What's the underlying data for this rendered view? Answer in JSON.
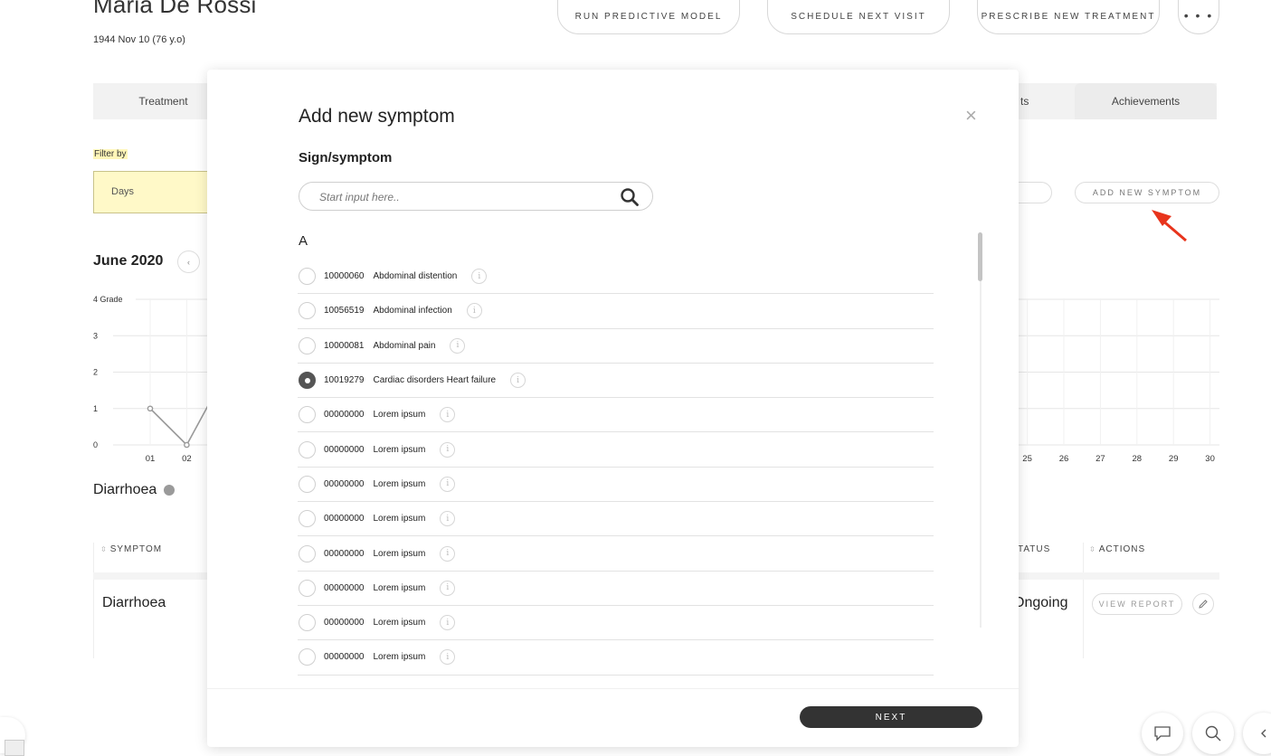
{
  "patient": {
    "name": "Maria De Rossi",
    "dob": "1944 Nov 10 (76 y.o)"
  },
  "top_actions": {
    "run_model": "RUN PREDICTIVE MODEL",
    "schedule_visit": "SCHEDULE NEXT VISIT",
    "prescribe": "PRESCRIBE NEW TREATMENT",
    "more": "• • •"
  },
  "tabs": {
    "treatment": "Treatment",
    "partial_tab": "ts",
    "achievements": "Achievements"
  },
  "filter": {
    "label": "Filter by",
    "value": "Days"
  },
  "add_symptom_button": "ADD NEW SYMPTOM",
  "calendar": {
    "month": "June 2020",
    "prev_icon": "chevron-left-icon"
  },
  "chart_data": {
    "type": "line",
    "ylabel": "",
    "yticks": [
      "4 Grade",
      "3",
      "2",
      "1",
      "0"
    ],
    "ylim": [
      0,
      4
    ],
    "x_ticks_visible_left": [
      "01",
      "02"
    ],
    "x_ticks_visible_right": [
      "25",
      "26",
      "27",
      "28",
      "29",
      "30"
    ],
    "grid": true,
    "series": [
      {
        "name": "Diarrhoea",
        "color": "#9a9a9a",
        "x": [
          "01",
          "02"
        ],
        "values": [
          1,
          0
        ]
      }
    ]
  },
  "legend": {
    "symptom": "Diarrhoea"
  },
  "table": {
    "headers": {
      "symptom": "SYMPTOM",
      "status": "TATUS",
      "actions": "ACTIONS"
    },
    "row": {
      "symptom": "Diarrhoea",
      "status": "Ongoing",
      "view_report": "VIEW REPORT"
    }
  },
  "modal": {
    "title": "Add new symptom",
    "close": "×",
    "subtitle": "Sign/symptom",
    "search_placeholder": "Start input here..",
    "letter": "A",
    "next": "NEXT",
    "items": [
      {
        "code": "10000060",
        "label": "Abdominal distention",
        "checked": false
      },
      {
        "code": "10056519",
        "label": "Abdominal infection",
        "checked": false
      },
      {
        "code": "10000081",
        "label": "Abdominal pain",
        "checked": false
      },
      {
        "code": "10019279",
        "label": "Cardiac disorders Heart failure",
        "checked": true
      },
      {
        "code": "00000000",
        "label": "Lorem ipsum",
        "checked": false
      },
      {
        "code": "00000000",
        "label": "Lorem ipsum",
        "checked": false
      },
      {
        "code": "00000000",
        "label": "Lorem ipsum",
        "checked": false
      },
      {
        "code": "00000000",
        "label": "Lorem ipsum",
        "checked": false
      },
      {
        "code": "00000000",
        "label": "Lorem ipsum",
        "checked": false
      },
      {
        "code": "00000000",
        "label": "Lorem ipsum",
        "checked": false
      },
      {
        "code": "00000000",
        "label": "Lorem ipsum",
        "checked": false
      },
      {
        "code": "00000000",
        "label": "Lorem ipsum",
        "checked": false
      }
    ]
  },
  "colors": {
    "filter_bg": "#fff9c8",
    "primary_dark": "#333333",
    "annotation_arrow": "#e8341c"
  }
}
